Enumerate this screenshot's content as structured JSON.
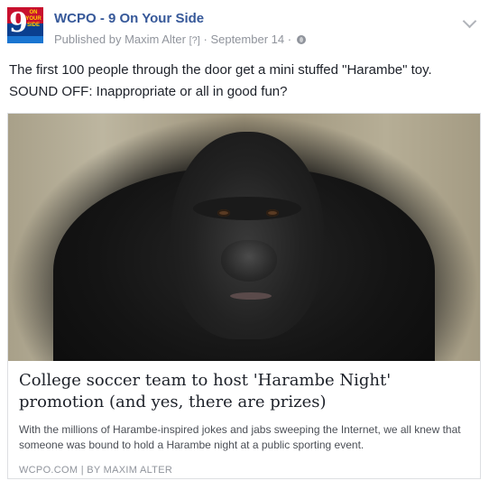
{
  "page": {
    "name": "WCPO - 9 On Your Side",
    "logo_text": "9",
    "logo_small": "ON YOUR SIDE"
  },
  "meta": {
    "published_by": "Published by",
    "author": "Maxim Alter",
    "help_marker": "[?]",
    "separator": "·",
    "date": "September 14"
  },
  "post": {
    "line1": "The first 100 people through the door get a mini stuffed \"Harambe\" toy.",
    "line2": "SOUND OFF: Inappropriate or all in good fun?"
  },
  "link": {
    "title": "College soccer team to host 'Harambe Night' promotion (and yes, there are prizes)",
    "description": "With the millions of Harambe-inspired jokes and jabs sweeping the Internet, we all knew that someone was bound to hold a Harambe night at a public sporting event.",
    "source": "WCPO.COM | BY MAXIM ALTER"
  },
  "colors": {
    "name_blue": "#365899",
    "meta_gray": "#90949c",
    "text": "#1d2129"
  },
  "icons": {
    "audience": "globe-icon",
    "options": "chevron-down-icon"
  }
}
